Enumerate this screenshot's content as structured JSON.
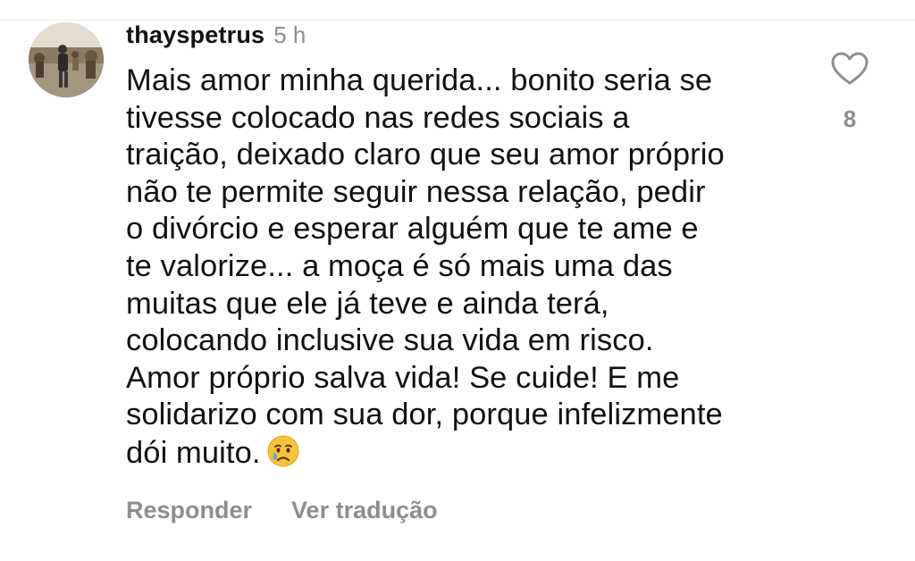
{
  "comment": {
    "username": "thayspetrus",
    "timestamp": "5 h",
    "text_lines": [
      "Mais amor minha querida... bonito seria se",
      "tivesse colocado nas redes sociais a",
      "traição, deixado claro que seu amor próprio",
      "não te permite seguir nessa relação, pedir",
      "o divórcio e esperar alguém que te ame e",
      "te valorize... a moça é só mais uma das",
      "muitas que ele já teve e ainda terá,",
      "colocando inclusive sua vida em risco.",
      "Amor próprio salva vida! Se cuide! E me",
      "solidarizo com sua dor, porque infelizmente",
      "dói muito."
    ],
    "emoji": "crying-face-icon",
    "like_count": "8",
    "like_icon": "heart-outline-icon"
  },
  "actions": {
    "reply_label": "Responder",
    "translate_label": "Ver tradução"
  },
  "colors": {
    "text": "#111111",
    "muted": "#8e8e8e",
    "emoji_face": "#f7c43c"
  }
}
